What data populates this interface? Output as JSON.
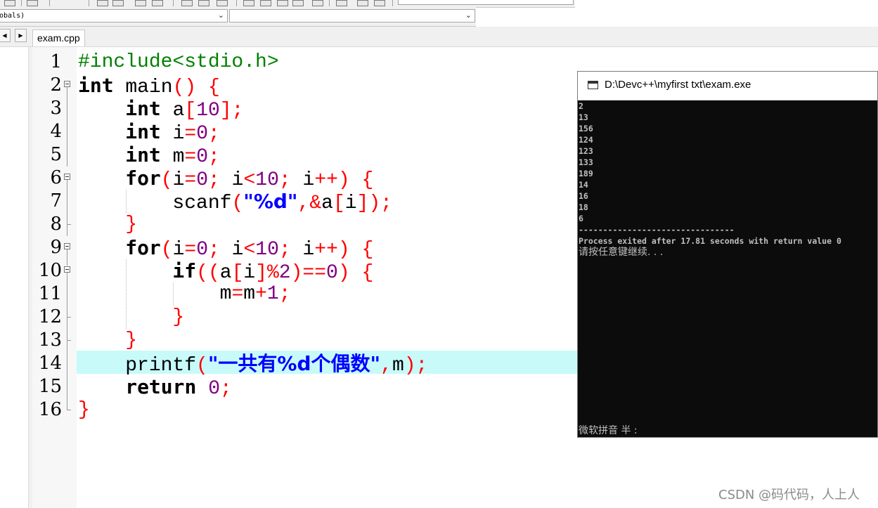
{
  "toolbar": {
    "scope_combo_value": "obals)",
    "function_combo_value": ""
  },
  "editor": {
    "file_tab": "exam.cpp",
    "line_numbers": [
      "1",
      "2",
      "3",
      "4",
      "5",
      "6",
      "7",
      "8",
      "9",
      "10",
      "11",
      "12",
      "13",
      "14",
      "15",
      "16"
    ],
    "highlighted_line": 14
  },
  "console": {
    "title": "D:\\Devc++\\myfirst txt\\exam.exe",
    "inputs": [
      "2",
      "13",
      "156",
      "124",
      "123",
      "133",
      "189",
      "14",
      "16",
      "18",
      "6"
    ],
    "separator": "--------------------------------",
    "exit_message": "Process exited after 17.81 seconds with return value 0",
    "continue_prompt": "请按任意键继续. . .",
    "ime_status": "微软拼音 半 :"
  },
  "watermark": "CSDN @码代码，人上人",
  "colors": {
    "keyword": "#000000",
    "operator": "#ff0000",
    "number": "#800080",
    "string": "#0000ff",
    "preprocessor": "#008000",
    "highlight": "#c8fafa",
    "console_bg": "#0c0c0c",
    "console_text": "#c0c0c0"
  },
  "icons": [
    "toolbar-button-icon",
    "dropdown-arrow-icon",
    "tab-scroll-left-icon",
    "tab-scroll-right-icon",
    "fold-marker-icon",
    "console-app-icon"
  ]
}
